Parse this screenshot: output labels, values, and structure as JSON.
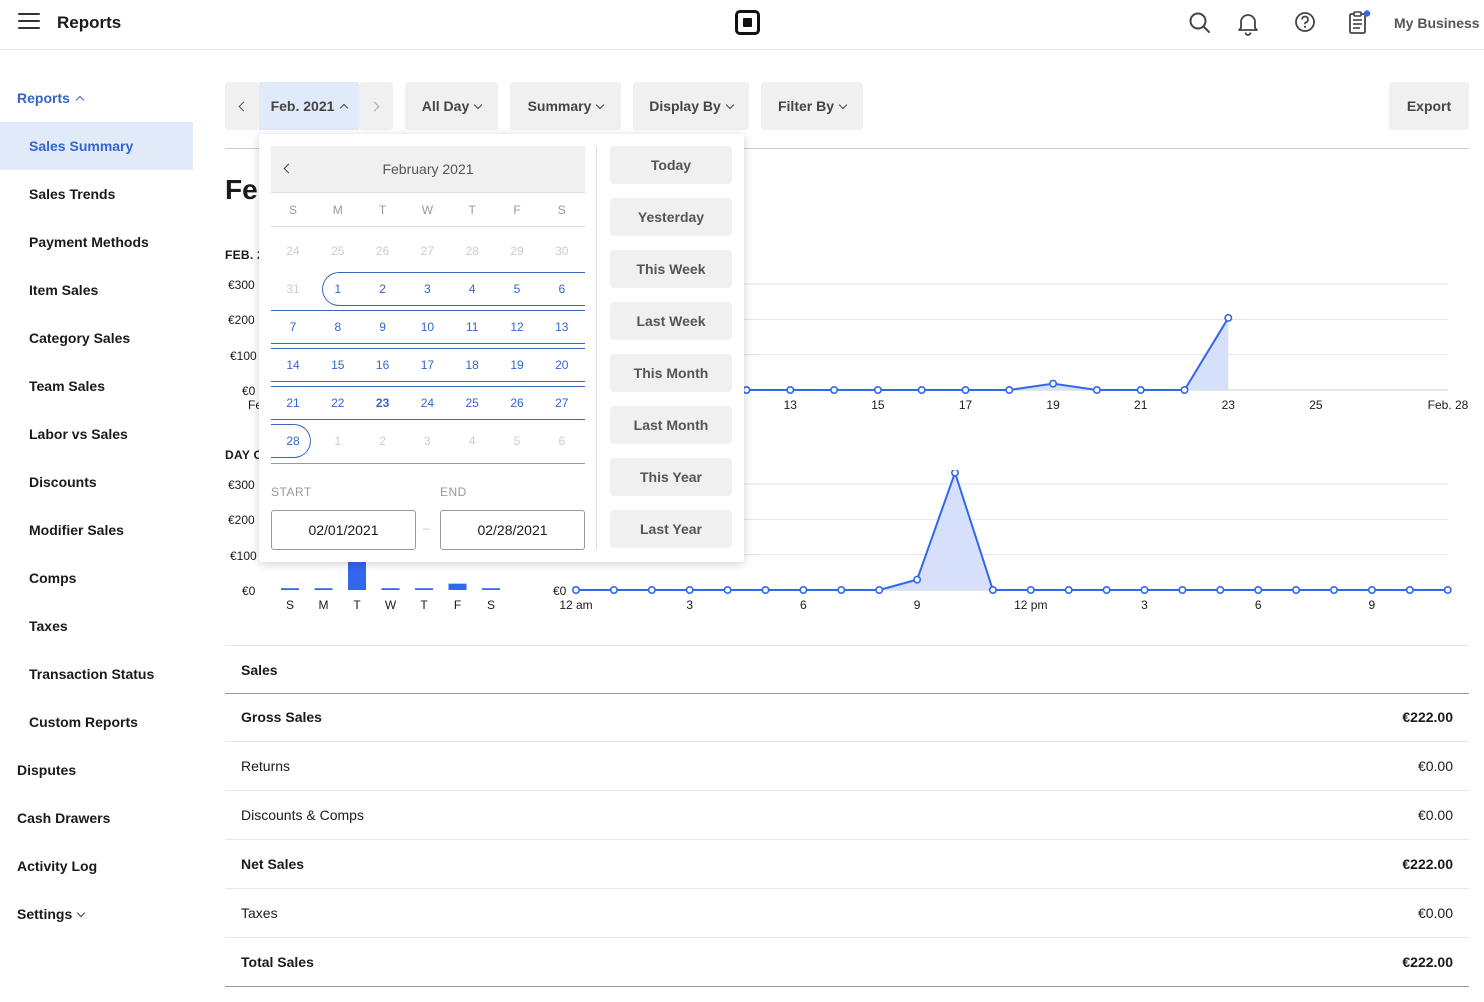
{
  "app": {
    "title": "Reports",
    "business": "My Business"
  },
  "sidebar": {
    "reports_label": "Reports",
    "items": [
      {
        "label": "Sales Summary"
      },
      {
        "label": "Sales Trends"
      },
      {
        "label": "Payment Methods"
      },
      {
        "label": "Item Sales"
      },
      {
        "label": "Category Sales"
      },
      {
        "label": "Team Sales"
      },
      {
        "label": "Labor vs Sales"
      },
      {
        "label": "Discounts"
      },
      {
        "label": "Modifier Sales"
      },
      {
        "label": "Comps"
      },
      {
        "label": "Taxes"
      },
      {
        "label": "Transaction Status"
      },
      {
        "label": "Custom Reports"
      }
    ],
    "top_items": [
      {
        "label": "Disputes"
      },
      {
        "label": "Cash Drawers"
      },
      {
        "label": "Activity Log"
      },
      {
        "label": "Settings"
      }
    ]
  },
  "toolbar": {
    "date_label": "Feb. 2021",
    "time_label": "All Day",
    "summary_label": "Summary",
    "display_label": "Display By",
    "filter_label": "Filter By",
    "export_label": "Export"
  },
  "page": {
    "heading_partial": "Fe"
  },
  "calendar": {
    "month_label": "February 2021",
    "weekdays": [
      "S",
      "M",
      "T",
      "W",
      "T",
      "F",
      "S"
    ],
    "weeks": [
      [
        "24",
        "25",
        "26",
        "27",
        "28",
        "29",
        "30"
      ],
      [
        "31",
        "1",
        "2",
        "3",
        "4",
        "5",
        "6"
      ],
      [
        "7",
        "8",
        "9",
        "10",
        "11",
        "12",
        "13"
      ],
      [
        "14",
        "15",
        "16",
        "17",
        "18",
        "19",
        "20"
      ],
      [
        "21",
        "22",
        "23",
        "24",
        "25",
        "26",
        "27"
      ],
      [
        "28",
        "1",
        "2",
        "3",
        "4",
        "5",
        "6"
      ]
    ],
    "start_label": "START",
    "end_label": "END",
    "start_value": "02/01/2021",
    "end_value": "02/28/2021",
    "range_dash": "–",
    "quick_ranges": [
      "Today",
      "Yesterday",
      "This Week",
      "Last Week",
      "This Month",
      "Last Month",
      "This Year",
      "Last Year"
    ]
  },
  "chart_data": [
    {
      "type": "area",
      "title_partial": "FEB. 2",
      "y_ticks": [
        "€300",
        "€200",
        "€100",
        "€0"
      ],
      "ylim": [
        0,
        300
      ],
      "x_tick_labels": [
        "Fe",
        "13",
        "15",
        "17",
        "19",
        "21",
        "23",
        "25",
        "Feb. 28"
      ],
      "x": [
        12,
        13,
        14,
        15,
        16,
        17,
        18,
        19,
        20,
        21,
        22,
        23
      ],
      "values": [
        0,
        0,
        0,
        0,
        0,
        0,
        0,
        18,
        0,
        0,
        0,
        204
      ],
      "color": "#3366ee"
    },
    {
      "type": "bar",
      "title_partial": "DAY O",
      "y_ticks": [
        "€300",
        "€200",
        "€100",
        "€0"
      ],
      "ylim": [
        0,
        300
      ],
      "categories": [
        "S",
        "M",
        "T",
        "W",
        "T",
        "F",
        "S"
      ],
      "values": [
        5,
        5,
        80,
        5,
        5,
        18,
        5
      ],
      "color": "#3366ee"
    },
    {
      "type": "area",
      "y_ticks": [
        "€0"
      ],
      "ylim": [
        0,
        200
      ],
      "x_tick_labels": [
        "12 am",
        "3",
        "6",
        "9",
        "12 pm",
        "3",
        "6",
        "9"
      ],
      "values": [
        0,
        0,
        0,
        0,
        0,
        0,
        0,
        0,
        0,
        18,
        204,
        0,
        0,
        0,
        0,
        0,
        0,
        0,
        0,
        0,
        0,
        0,
        0,
        0
      ],
      "color": "#3366ee"
    }
  ],
  "sales_table": {
    "header": "Sales",
    "rows": [
      {
        "label": "Gross Sales",
        "value": "€222.00",
        "bold": true
      },
      {
        "label": "Returns",
        "value": "€0.00",
        "bold": false
      },
      {
        "label": "Discounts & Comps",
        "value": "€0.00",
        "bold": false
      },
      {
        "label": "Net Sales",
        "value": "€222.00",
        "bold": true
      },
      {
        "label": "Taxes",
        "value": "€0.00",
        "bold": false
      },
      {
        "label": "Total Sales",
        "value": "€222.00",
        "bold": true
      }
    ]
  },
  "icons": [
    "menu-icon",
    "square-logo-icon",
    "search-icon",
    "bell-icon",
    "help-icon",
    "clipboard-icon",
    "chevron-left-icon",
    "chevron-right-icon",
    "chevron-down-icon",
    "chevron-up-icon"
  ],
  "colors": {
    "accent": "#3366cc",
    "chart": "#3366ee",
    "active_bg": "#e0eaf8",
    "notification_dot": "#3366ee"
  }
}
